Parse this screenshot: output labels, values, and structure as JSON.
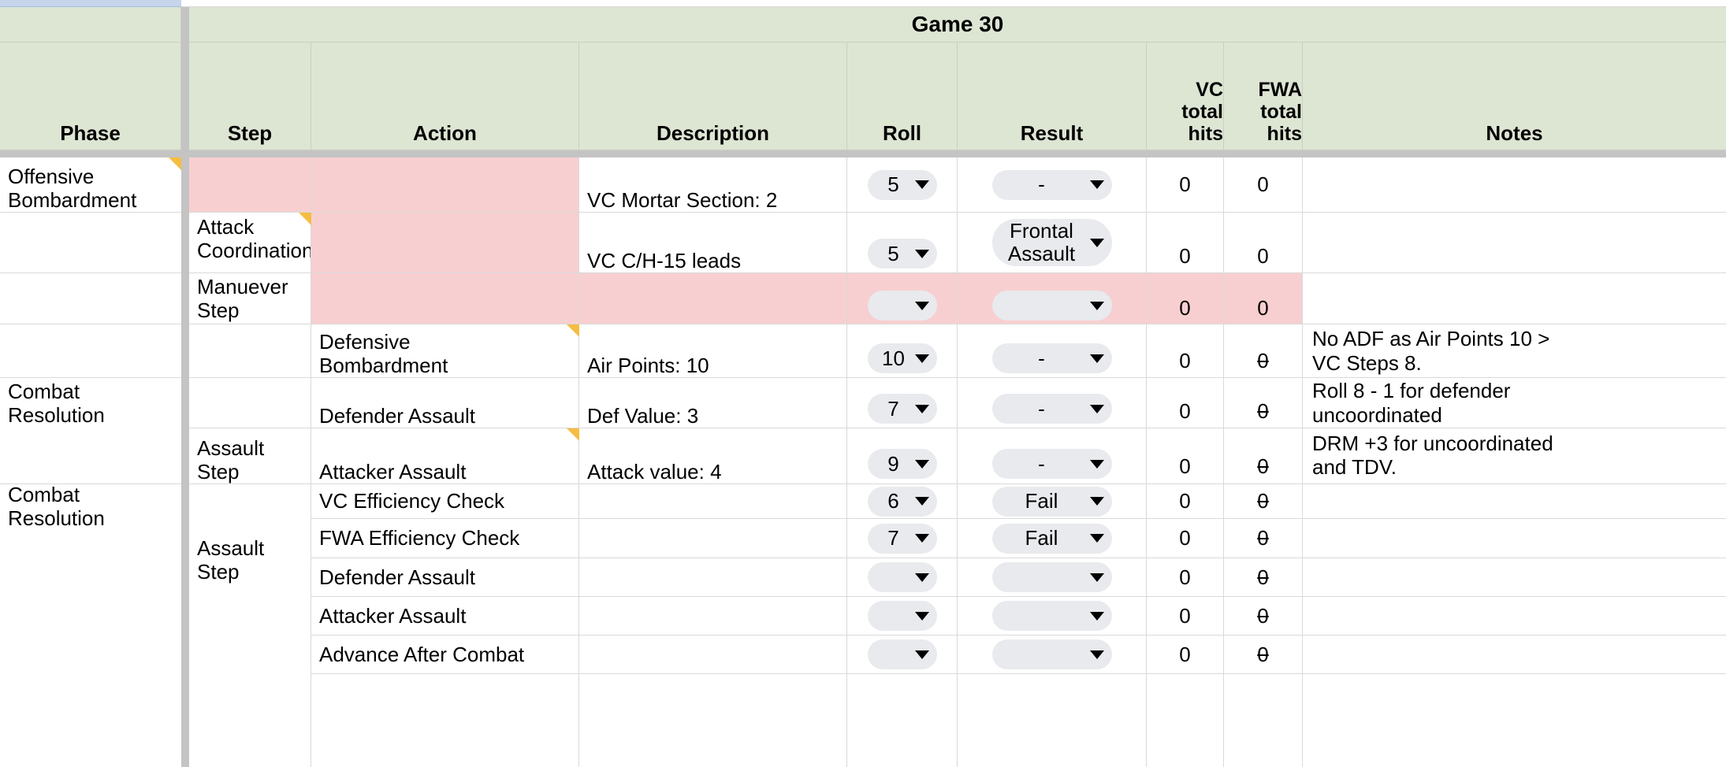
{
  "title": "Game 30",
  "columns": [
    {
      "key": "phase",
      "label": "Phase"
    },
    {
      "key": "step",
      "label": "Step"
    },
    {
      "key": "action",
      "label": "Action"
    },
    {
      "key": "description",
      "label": "Description"
    },
    {
      "key": "roll",
      "label": "Roll"
    },
    {
      "key": "result",
      "label": "Result"
    },
    {
      "key": "vc_total_hits",
      "label": "VC\ntotal\nhits"
    },
    {
      "key": "fwa_total_hits",
      "label": "FWA\ntotal\nhits"
    },
    {
      "key": "notes",
      "label": "Notes"
    }
  ],
  "header_labels": {
    "phase": "Phase",
    "step": "Step",
    "action": "Action",
    "description": "Description",
    "roll": "Roll",
    "result": "Result",
    "vc_line1": "VC",
    "vc_line2": "total",
    "vc_line3": "hits",
    "fwa_line1": "FWA",
    "fwa_line2": "total",
    "fwa_line3": "hits",
    "notes": "Notes"
  },
  "phases": [
    {
      "label": "Offensive\nBombardment"
    },
    {
      "label": "Combat\nResolution"
    }
  ],
  "steps": [
    {
      "label": "Attack\nCoordination"
    },
    {
      "label": "Manuever\nStep"
    },
    {
      "label": "Assault Step"
    }
  ],
  "rows": [
    {
      "id": "r1",
      "phase": "Offensive\nBombardment",
      "step": "",
      "action": "",
      "description": "VC Mortar Section: 2",
      "roll": "5",
      "result": "-",
      "vc_total_hits": "0",
      "fwa_total_hits": "0",
      "fwa_strike": false,
      "notes": "",
      "action_pink": true,
      "step_pink": true,
      "phase_comment": true
    },
    {
      "id": "r2",
      "phase": "",
      "step": "Attack\nCoordination",
      "action": "",
      "description": "VC C/H-15 leads",
      "roll": "5",
      "result": "Frontal\nAssault",
      "vc_total_hits": "0",
      "fwa_total_hits": "0",
      "fwa_strike": false,
      "notes": "",
      "action_pink": true,
      "step_comment": true
    },
    {
      "id": "r3",
      "phase": "",
      "step": "Manuever\nStep",
      "action": "",
      "description": "",
      "roll": "",
      "result": "",
      "vc_total_hits": "0",
      "fwa_total_hits": "0",
      "fwa_strike": false,
      "notes": "",
      "row_pink": true
    },
    {
      "id": "r4",
      "phase": "",
      "step": "",
      "action": "Defensive\nBombardment",
      "description": "Air Points: 10",
      "roll": "10",
      "result": "-",
      "vc_total_hits": "0",
      "fwa_total_hits": "0",
      "fwa_strike": true,
      "notes": "No ADF as Air Points 10 >\nVC Steps 8.",
      "action_comment": true
    },
    {
      "id": "r5",
      "phase": "Combat\nResolution",
      "step": "",
      "action": "Defender Assault",
      "description": "Def Value: 3",
      "roll": "7",
      "result": "-",
      "vc_total_hits": "0",
      "fwa_total_hits": "0",
      "fwa_strike": true,
      "notes": "Roll 8 - 1 for defender\nuncoordinated"
    },
    {
      "id": "r6",
      "phase": "",
      "step": "Assault Step",
      "action": "Attacker Assault",
      "description": "Attack value: 4",
      "roll": "9",
      "result": "-",
      "vc_total_hits": "0",
      "fwa_total_hits": "0",
      "fwa_strike": true,
      "notes": "DRM +3 for uncoordinated\nand TDV.",
      "action_comment": true
    },
    {
      "id": "r7",
      "phase": "",
      "step": "",
      "action": "VC Efficiency Check",
      "description": "",
      "roll": "6",
      "result": "Fail",
      "vc_total_hits": "0",
      "fwa_total_hits": "0",
      "fwa_strike": true,
      "notes": ""
    },
    {
      "id": "r8",
      "phase": "",
      "step": "",
      "action": "FWA Efficiency Check",
      "description": "",
      "roll": "7",
      "result": "Fail",
      "vc_total_hits": "0",
      "fwa_total_hits": "0",
      "fwa_strike": true,
      "notes": ""
    },
    {
      "id": "r9",
      "phase": "",
      "step": "",
      "action": "Defender Assault",
      "description": "",
      "roll": "",
      "result": "",
      "vc_total_hits": "0",
      "fwa_total_hits": "0",
      "fwa_strike": true,
      "notes": ""
    },
    {
      "id": "r10",
      "phase": "",
      "step": "",
      "action": "Attacker Assault",
      "description": "",
      "roll": "",
      "result": "",
      "vc_total_hits": "0",
      "fwa_total_hits": "0",
      "fwa_strike": true,
      "notes": ""
    },
    {
      "id": "r11",
      "phase": "",
      "step": "",
      "action": "Advance After Combat",
      "description": "",
      "roll": "",
      "result": "",
      "vc_total_hits": "0",
      "fwa_total_hits": "0",
      "fwa_strike": true,
      "notes": ""
    }
  ],
  "colors": {
    "header_green": "#dde5d3",
    "highlight_pink": "#f8cfd0",
    "chip_gray": "#e8eaed",
    "comment_orange": "#f5bd42",
    "selection_blue": "#c7d5ec",
    "gridline": "#d9d9d9",
    "freeze_divider": "#c4c4c4"
  }
}
